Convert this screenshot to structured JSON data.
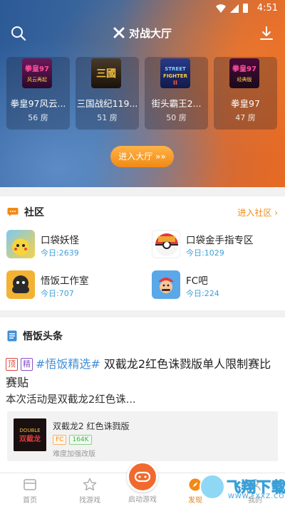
{
  "status": {
    "time": "4:51"
  },
  "header": {
    "title": "对战大厅",
    "search_icon": "search-icon",
    "download_icon": "download-icon"
  },
  "hall": {
    "games": [
      {
        "name": "拳皇97风云...",
        "rooms": "56 房",
        "thumb_text": "拳皇97 风云再起",
        "color": "#5a1a4a"
      },
      {
        "name": "三国战纪119...",
        "rooms": "51 房",
        "thumb_text": "三国",
        "color": "#3a2a1a"
      },
      {
        "name": "街头霸王2...",
        "rooms": "50 房",
        "thumb_text": "STREET FIGHTER II",
        "color": "#1a2a5a"
      },
      {
        "name": "拳皇97",
        "rooms": "47 房",
        "thumb_text": "拳皇97 经典版",
        "color": "#3a0a2a"
      }
    ],
    "enter_label": "进入大厅 »»"
  },
  "community": {
    "title": "社区",
    "more": "进入社区 ›",
    "forums": [
      {
        "name": "口袋妖怪",
        "today": "今日:2639",
        "color": "#f5d24a"
      },
      {
        "name": "口袋金手指专区",
        "today": "今日:1029",
        "color": "#e23a3a"
      },
      {
        "name": "悟饭工作室",
        "today": "今日:707",
        "color": "#f2b233"
      },
      {
        "name": "FC吧",
        "today": "今日:224",
        "color": "#5aa8e8"
      }
    ]
  },
  "news": {
    "title": "悟饭头条",
    "tag_top": "顶",
    "tag_best": "精",
    "hashtag": "#悟饭精选#",
    "headline": " 双截龙2红色诛戮版单人限制赛比赛贴",
    "summary": "本次活动是双截龙2红色诛...",
    "card": {
      "title": "双截龙2 红色诛戮版",
      "badge_platform": "FC",
      "badge_size": "164K",
      "desc": "难度加强改版",
      "thumb_text": "双截龙"
    }
  },
  "nav": {
    "items": [
      {
        "label": "首页"
      },
      {
        "label": "找游戏"
      },
      {
        "label": "启动游戏"
      },
      {
        "label": "发现"
      },
      {
        "label": "我的"
      }
    ],
    "active_color": "#e0801a"
  },
  "watermark": {
    "text": "飞翔下载",
    "sub": "WWW.FXXZ.COM"
  }
}
